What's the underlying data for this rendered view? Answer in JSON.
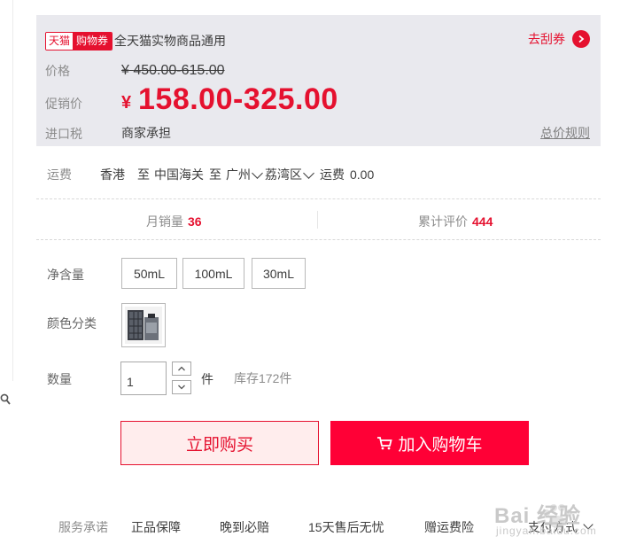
{
  "coupon": {
    "tag_left": "天猫",
    "tag_right": "购物券",
    "desc": "全天猫实物商品通用",
    "action": "去刮券"
  },
  "price": {
    "label": "价格",
    "original": "450.00-615.00",
    "currency": "¥",
    "promo_label": "促销价",
    "promo": "158.00-325.00",
    "tax_label": "进口税",
    "tax_value": "商家承担",
    "rule_link": "总价规则"
  },
  "shipping": {
    "label": "运费",
    "from": "香港",
    "to1_prefix": "至",
    "to1": "中国海关",
    "to2_prefix": "至",
    "city": "广州",
    "district": "荔湾区",
    "fee_label": "运费",
    "fee": "0.00"
  },
  "stats": {
    "sales_label": "月销量",
    "sales": "36",
    "reviews_label": "累计评价",
    "reviews": "444"
  },
  "sku": {
    "volume_label": "净含量",
    "volumes": [
      "50mL",
      "100mL",
      "30mL"
    ],
    "color_label": "颜色分类",
    "qty_label": "数量",
    "qty": "1",
    "unit": "件",
    "stock": "库存172件"
  },
  "actions": {
    "buy_now": "立即购买",
    "add_cart": "加入购物车"
  },
  "service": {
    "label": "服务承诺",
    "items": [
      "正品保障",
      "晚到必赔",
      "15天售后无忧",
      "赠运费险"
    ],
    "pay": "支付方式"
  },
  "watermark": {
    "brand": "Bai 经验",
    "url": "jingyan.baidu.com"
  },
  "colors": {
    "accent": "#e5112f",
    "cart_bg": "#ff0036",
    "price_bg": "#e9e9ee"
  },
  "icons": [
    "search-icon",
    "chevron-right-icon",
    "chevron-down-icon",
    "cart-icon",
    "stepper-up-icon",
    "stepper-down-icon"
  ]
}
